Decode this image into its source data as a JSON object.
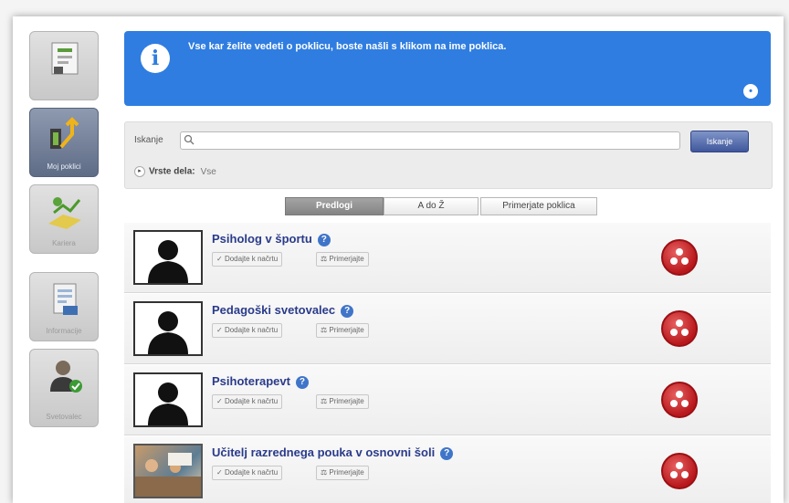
{
  "sidebar": {
    "items": [
      {
        "label": "",
        "icon": "clipboard-icon"
      },
      {
        "label": "Moj poklici",
        "icon": "chart-arrow-icon"
      },
      {
        "label": "Kariera",
        "icon": "growth-icon"
      },
      {
        "label": "Informacije",
        "icon": "document-icon"
      },
      {
        "label": "Svetovalec",
        "icon": "user-check-icon"
      }
    ]
  },
  "info": {
    "text": "Vse kar želite vedeti o poklicu, boste našli s klikom na ime poklica.",
    "icon": "info-icon"
  },
  "search": {
    "label": "Iskanje",
    "value": "",
    "placeholder": "",
    "button_label": "Iskanje"
  },
  "filter": {
    "label": "Vrste dela:",
    "value": "Vse"
  },
  "tabs": [
    {
      "label": "Predlogi",
      "active": true
    },
    {
      "label": "A do Ž",
      "active": false
    },
    {
      "label": "Primerjate poklica",
      "active": false
    }
  ],
  "jobs": [
    {
      "title": "Psiholog v športu",
      "add_label": "Dodajte k načrtu",
      "compare_label": "Primerjajte"
    },
    {
      "title": "Pedagoški svetovalec",
      "add_label": "Dodajte k načrtu",
      "compare_label": "Primerjajte"
    },
    {
      "title": "Psihoterapevt",
      "add_label": "Dodajte k načrtu",
      "compare_label": "Primerjajte"
    },
    {
      "title": "Učitelj razrednega pouka v osnovni šoli",
      "add_label": "Dodajte k načrtu",
      "compare_label": "Primerjajte"
    }
  ],
  "colors": {
    "banner": "#2f7de0",
    "title": "#2a3b8a",
    "badge": "#c1272d"
  }
}
